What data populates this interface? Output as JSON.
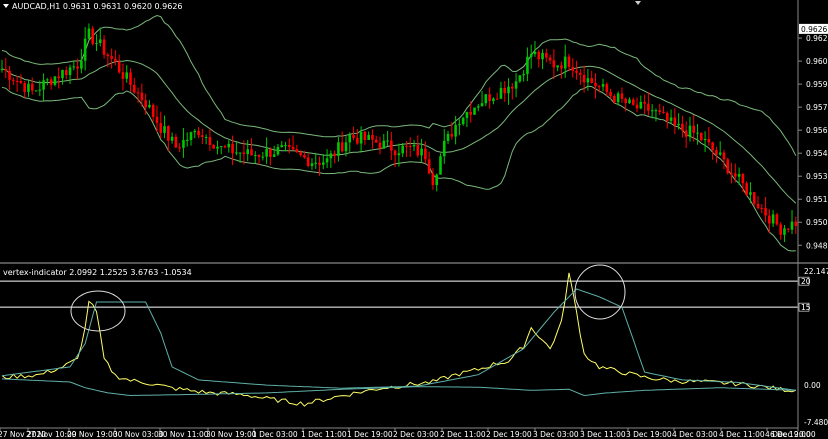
{
  "main": {
    "symbol": "AUDCAD,H1",
    "ohlc": "0.9631 0.9631 0.9620 0.9626",
    "current_price": "0.9626",
    "price_ticks": [
      "0.9620",
      "0.9605",
      "0.9590",
      "0.9575",
      "0.9560",
      "0.9545",
      "0.9530",
      "0.9515",
      "0.9500",
      "0.9485"
    ],
    "ylim": [
      0.9478,
      0.9637
    ]
  },
  "indicator": {
    "title": "vertex-indicator 2.0992 1.2525 3.6763 -1.0534",
    "ticks": [
      "22.147",
      "20",
      "15",
      "0.00",
      "-7.4807"
    ],
    "ylim": [
      -7.4807,
      22.147
    ]
  },
  "time_labels": [
    "27 Nov 2020",
    "27 Nov 10:00",
    "29 Nov 19:00",
    "30 Nov 03:00",
    "30 Nov 11:00",
    "30 Nov 19:00",
    "1 Dec 03:00",
    "1 Dec 11:00",
    "1 Dec 19:00",
    "2 Dec 03:00",
    "2 Dec 11:00",
    "2 Dec 19:00",
    "3 Dec 03:00",
    "3 Dec 11:00",
    "3 Dec 19:00",
    "4 Dec 03:00",
    "4 Dec 11:00",
    "4 Dec 19:00",
    "6 Dec 20:00"
  ],
  "colors": {
    "bull": "#00c800",
    "bear": "#ff0000",
    "band": "#7ab87a",
    "signal": "#ffff66",
    "ind_band": "#5fb0a8",
    "level": "#ffffff"
  },
  "chart_data": [
    {
      "type": "candlestick",
      "title": "AUDCAD,H1",
      "ylim": [
        0.9478,
        0.9637
      ],
      "anchors_close": [
        [
          0,
          0.96
        ],
        [
          8,
          0.9585
        ],
        [
          14,
          0.9595
        ],
        [
          20,
          0.9603
        ],
        [
          23,
          0.9622
        ],
        [
          26,
          0.9615
        ],
        [
          30,
          0.9603
        ],
        [
          34,
          0.959
        ],
        [
          38,
          0.9578
        ],
        [
          42,
          0.9562
        ],
        [
          46,
          0.9549
        ],
        [
          52,
          0.956
        ],
        [
          58,
          0.9548
        ],
        [
          66,
          0.9544
        ],
        [
          74,
          0.9547
        ],
        [
          82,
          0.954
        ],
        [
          86,
          0.954
        ],
        [
          92,
          0.9556
        ],
        [
          98,
          0.9553
        ],
        [
          104,
          0.9548
        ],
        [
          108,
          0.9548
        ],
        [
          112,
          0.9544
        ],
        [
          114,
          0.9528
        ],
        [
          117,
          0.955
        ],
        [
          121,
          0.9568
        ],
        [
          126,
          0.9578
        ],
        [
          131,
          0.9585
        ],
        [
          136,
          0.9592
        ],
        [
          140,
          0.961
        ],
        [
          146,
          0.9603
        ],
        [
          150,
          0.9605
        ],
        [
          155,
          0.9593
        ],
        [
          161,
          0.9583
        ],
        [
          167,
          0.9575
        ],
        [
          172,
          0.9573
        ],
        [
          178,
          0.9562
        ],
        [
          184,
          0.9557
        ],
        [
          190,
          0.9542
        ],
        [
          196,
          0.9524
        ],
        [
          202,
          0.9506
        ],
        [
          206,
          0.9496
        ],
        [
          210,
          0.95
        ]
      ]
    },
    {
      "type": "line",
      "title": "vertex-indicator 2.0992 1.2525 3.6763 -1.0534",
      "ylim": [
        -7.4807,
        22.147
      ],
      "levels": [
        20,
        15
      ],
      "series": [
        {
          "values_anchors": [
            [
              0,
              1.5
            ],
            [
              10,
              2.0
            ],
            [
              16,
              3.5
            ],
            [
              20,
              5.0
            ],
            [
              22,
              11
            ],
            [
              23,
              16.3
            ],
            [
              25,
              14
            ],
            [
              27,
              5
            ],
            [
              30,
              1.8
            ],
            [
              34,
              0.9
            ],
            [
              38,
              0.5
            ],
            [
              45,
              -0.6
            ],
            [
              55,
              -1.5
            ],
            [
              64,
              -1.8
            ],
            [
              70,
              -2.6
            ],
            [
              80,
              -3.6
            ],
            [
              90,
              -2.0
            ],
            [
              100,
              -0.6
            ],
            [
              108,
              0.1
            ],
            [
              114,
              0.6
            ],
            [
              120,
              2.0
            ],
            [
              126,
              3.0
            ],
            [
              130,
              4.0
            ],
            [
              134,
              4.6
            ],
            [
              138,
              7.5
            ],
            [
              140,
              11
            ],
            [
              142,
              9.5
            ],
            [
              145,
              7.0
            ],
            [
              148,
              12
            ],
            [
              150,
              21.5
            ],
            [
              152,
              14
            ],
            [
              154,
              6
            ],
            [
              158,
              3.5
            ],
            [
              164,
              2.5
            ],
            [
              170,
              1.5
            ],
            [
              178,
              0.8
            ],
            [
              186,
              0.6
            ],
            [
              194,
              0.3
            ],
            [
              200,
              -0.2
            ],
            [
              206,
              -0.8
            ],
            [
              210,
              -1.0
            ]
          ]
        },
        {
          "values_anchors": [
            [
              0,
              1.8
            ],
            [
              18,
              3.5
            ],
            [
              22,
              8
            ],
            [
              25,
              16
            ],
            [
              38,
              16
            ],
            [
              42,
              10
            ],
            [
              45,
              3.5
            ],
            [
              52,
              1.0
            ],
            [
              70,
              0.0
            ],
            [
              90,
              -0.6
            ],
            [
              110,
              -0.2
            ],
            [
              126,
              2.0
            ],
            [
              138,
              7.0
            ],
            [
              146,
              14
            ],
            [
              152,
              18.5
            ],
            [
              158,
              17
            ],
            [
              164,
              15
            ],
            [
              170,
              2.5
            ],
            [
              180,
              1.0
            ],
            [
              195,
              0.5
            ],
            [
              210,
              -1.0
            ]
          ]
        },
        {
          "values_anchors": [
            [
              0,
              1.2
            ],
            [
              18,
              0.6
            ],
            [
              22,
              -0.5
            ],
            [
              28,
              -1.5
            ],
            [
              34,
              -2.0
            ],
            [
              50,
              -1.8
            ],
            [
              70,
              -1.5
            ],
            [
              90,
              -0.8
            ],
            [
              110,
              -0.3
            ],
            [
              126,
              -0.4
            ],
            [
              140,
              -1.0
            ],
            [
              150,
              -0.8
            ],
            [
              154,
              -2.0
            ],
            [
              160,
              -1.5
            ],
            [
              170,
              -1.0
            ],
            [
              190,
              -0.5
            ],
            [
              210,
              -1.0
            ]
          ]
        }
      ]
    }
  ]
}
